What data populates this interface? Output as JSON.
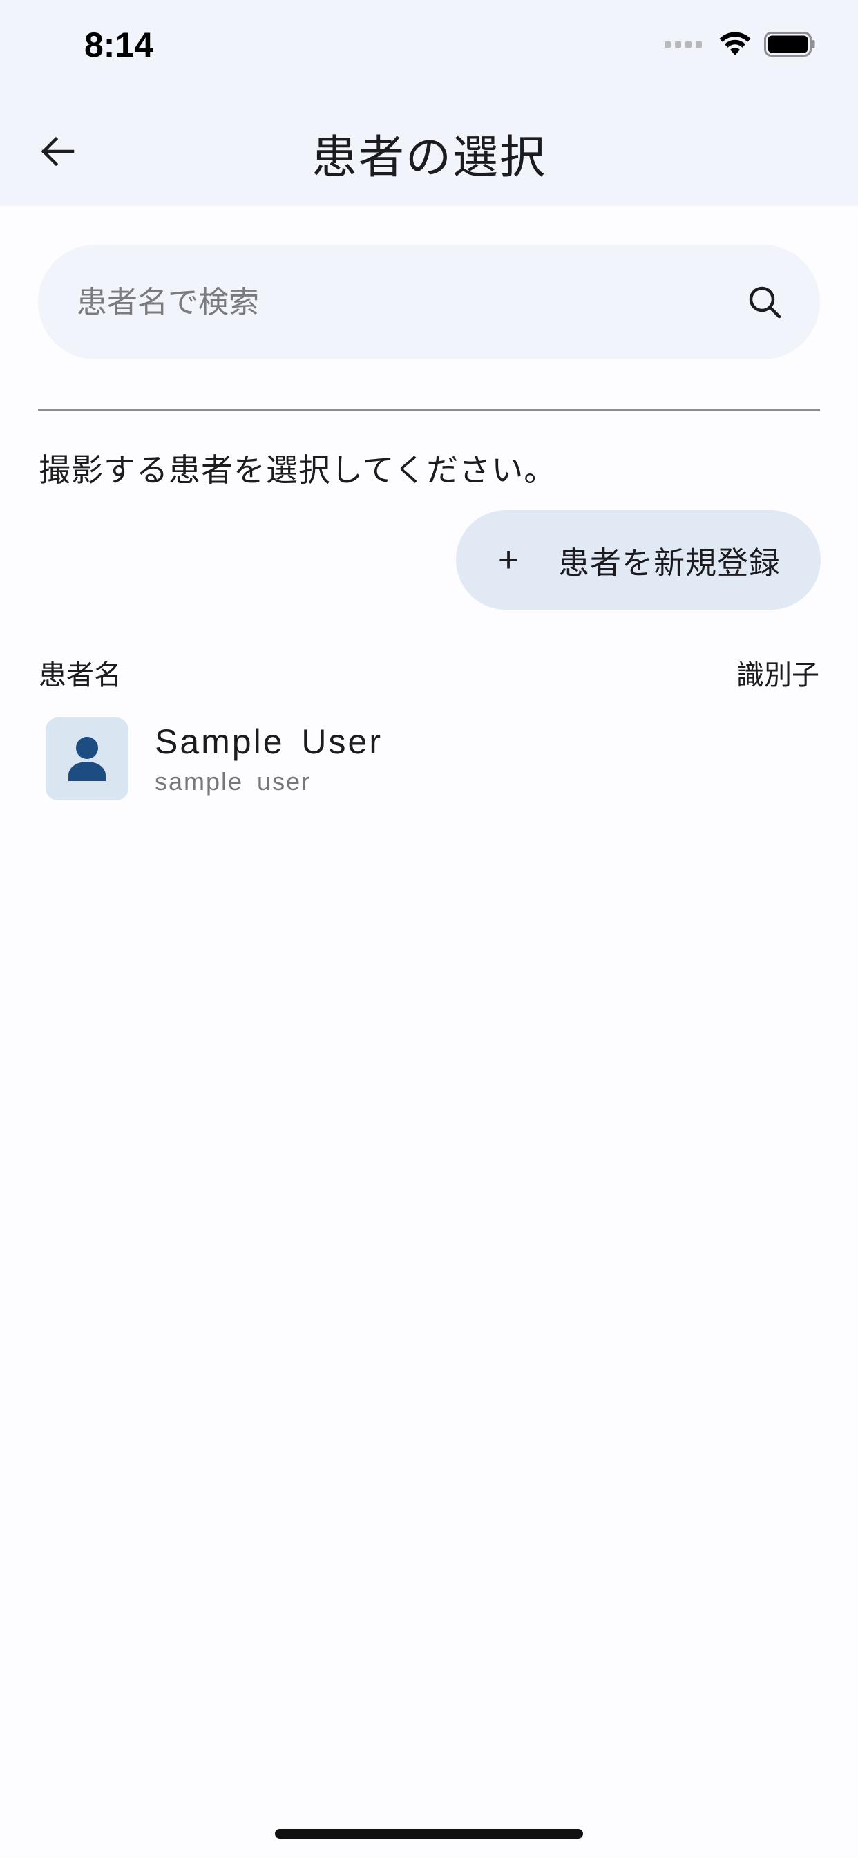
{
  "status_bar": {
    "time": "8:14"
  },
  "app_bar": {
    "title": "患者の選択",
    "back_icon": "arrow-left-icon"
  },
  "search": {
    "placeholder": "患者名で検索",
    "value": "",
    "icon": "search-icon"
  },
  "instruction": "撮影する患者を選択してください。",
  "register_button": {
    "icon": "plus-icon",
    "plus_glyph": "+",
    "label": "患者を新規登録"
  },
  "columns": {
    "name": "患者名",
    "identifier": "識別子"
  },
  "patients": [
    {
      "name": "Sample User",
      "subtitle": "sample user",
      "icon": "person-icon"
    }
  ],
  "colors": {
    "top_bar_bg": "#f1f4fa",
    "button_bg": "#e1e9f4",
    "avatar_bg": "#dae5f2",
    "avatar_icon": "#1d4d80",
    "background": "#fdfcfe"
  }
}
